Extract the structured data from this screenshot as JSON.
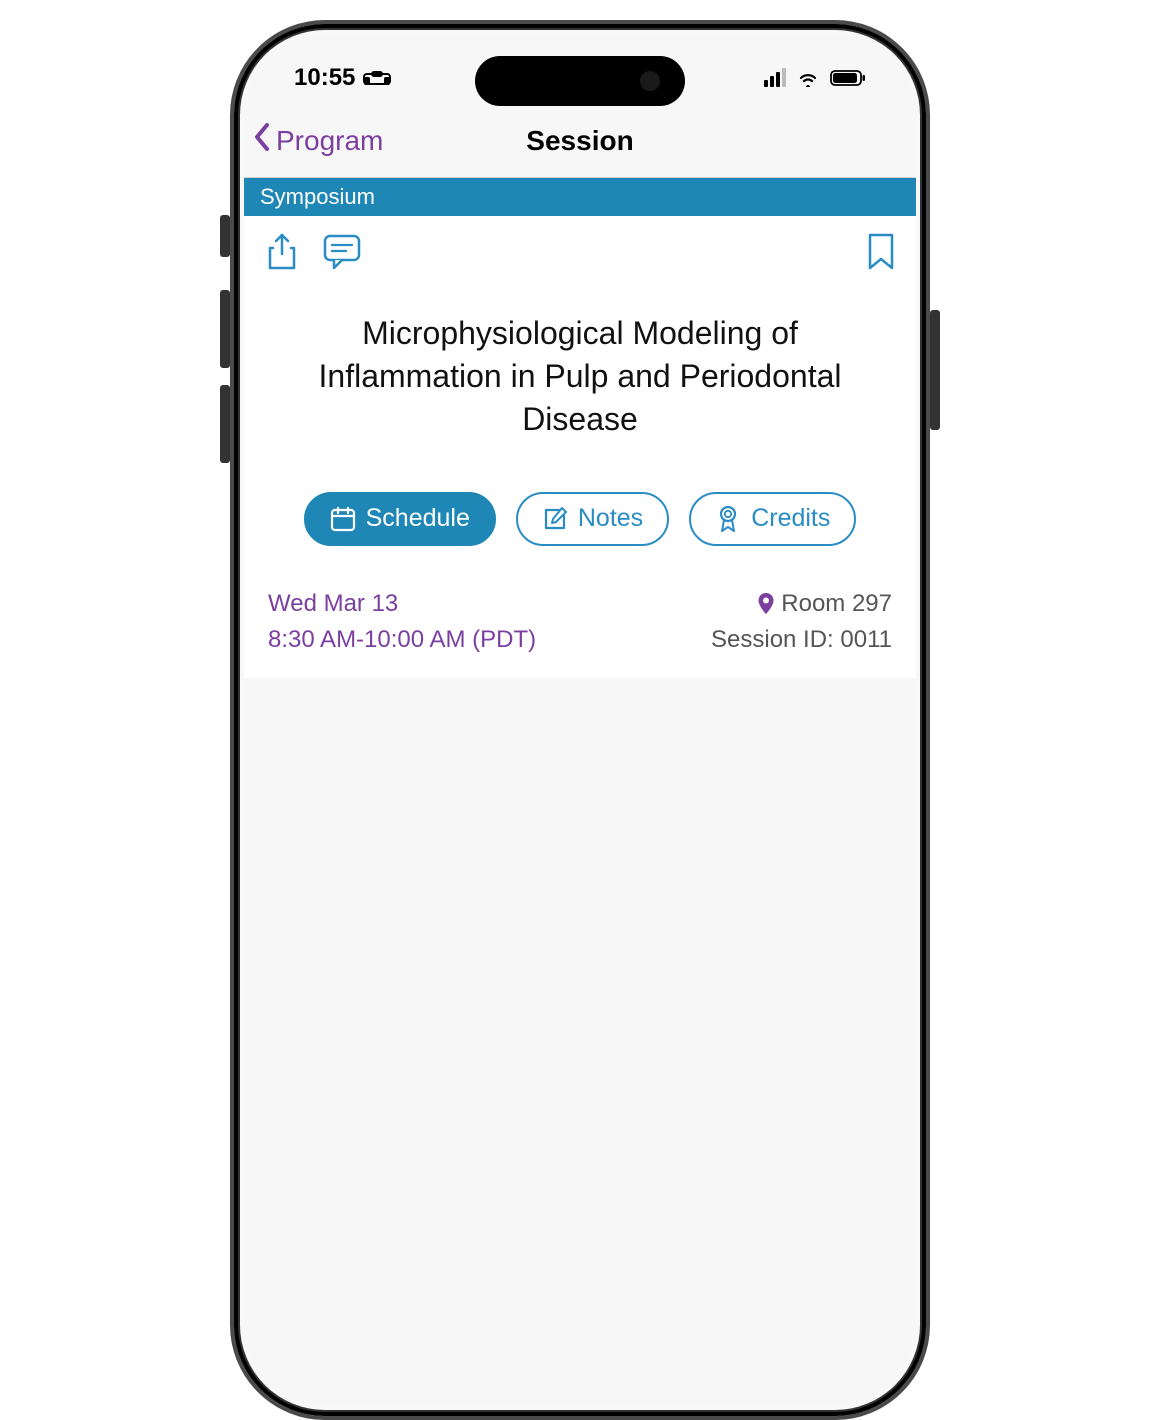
{
  "status": {
    "time": "10:55"
  },
  "nav": {
    "back_label": "Program",
    "title": "Session"
  },
  "category": {
    "label": "Symposium"
  },
  "session": {
    "title": "Microphysiological Modeling of Inflammation in Pulp and Periodontal Disease"
  },
  "actions": {
    "schedule_label": "Schedule",
    "notes_label": "Notes",
    "credits_label": "Credits"
  },
  "meta": {
    "date": "Wed Mar 13",
    "time": "8:30 AM-10:00 AM (PDT)",
    "room": "Room 297",
    "session_id": "Session ID: 0011"
  },
  "colors": {
    "accent_purple": "#7b3fa0",
    "accent_blue": "#1e87b5",
    "icon_blue": "#2a8cc4"
  }
}
